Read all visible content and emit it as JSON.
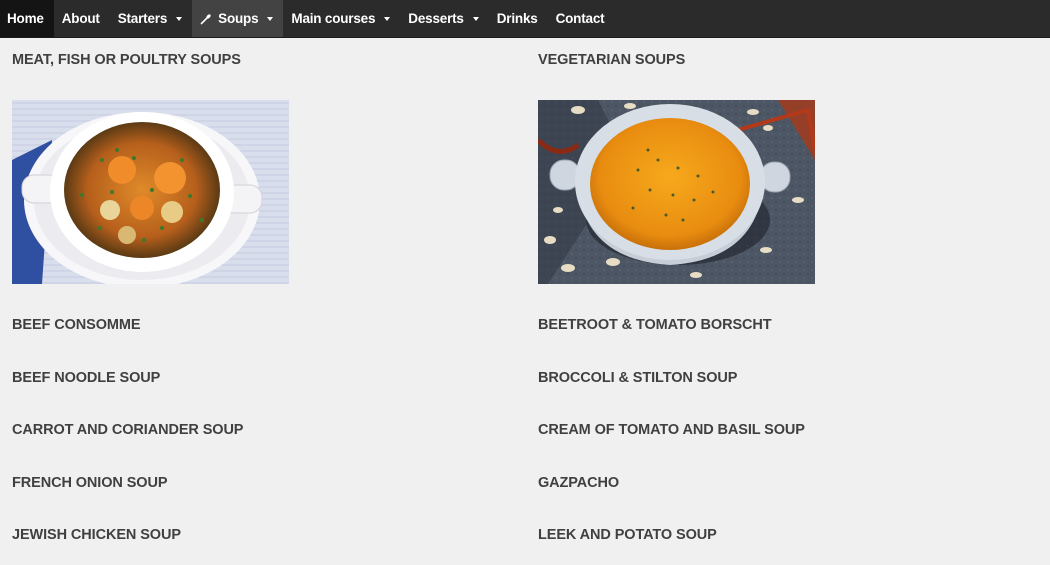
{
  "nav": {
    "items": [
      {
        "label": "Home"
      },
      {
        "label": "About"
      },
      {
        "label": "Starters"
      },
      {
        "label": "Soups"
      },
      {
        "label": "Main courses"
      },
      {
        "label": "Desserts"
      },
      {
        "label": "Drinks"
      },
      {
        "label": "Contact"
      }
    ]
  },
  "left": {
    "heading": "MEAT, FISH OR POULTRY SOUPS",
    "items": [
      "BEEF CONSOMME",
      "BEEF NOODLE SOUP",
      "CARROT AND CORIANDER SOUP",
      "FRENCH ONION SOUP",
      "JEWISH CHICKEN SOUP"
    ]
  },
  "right": {
    "heading": "VEGETARIAN SOUPS",
    "items": [
      "BEETROOT & TOMATO BORSCHT",
      "BROCCOLI & STILTON SOUP",
      "CREAM OF TOMATO AND BASIL SOUP",
      "GAZPACHO",
      "LEEK AND POTATO SOUP"
    ]
  },
  "colors": {
    "nav_bg": "#2b2b2b",
    "nav_home_bg": "#141414",
    "nav_active_bg": "#434343",
    "page_bg": "#f0f0f0",
    "text": "#404040"
  }
}
